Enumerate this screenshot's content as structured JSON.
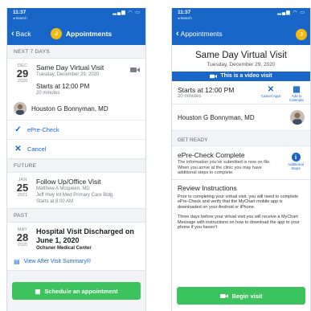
{
  "colors": {
    "brand_blue": "#1866c8",
    "accent_green": "#3cc35e",
    "avatar_yellow": "#f5b90f"
  },
  "status_bar": {
    "time": "11:37",
    "back_app": "◂ Search"
  },
  "left": {
    "nav": {
      "back_label": "Back",
      "avatar_letter": "J",
      "title": "Appointments"
    },
    "sections": {
      "next": "NEXT 7 DAYS",
      "future": "FUTURE",
      "past": "PAST"
    },
    "next_appt": {
      "month": "DEC",
      "day": "29",
      "year": "2020",
      "title": "Same Day Virtual Visit",
      "date": "Tuesday, December 29, 2020",
      "time": "Starts at 12:00 PM",
      "duration": "20 minutes",
      "provider": "Houston G Bonnyman, MD",
      "actions": [
        "ePre-Check",
        "Cancel"
      ]
    },
    "future_appt": {
      "month": "JAN",
      "day": "25",
      "year": "2021",
      "title": "Follow Up/Office Visit",
      "provider": "Matthew A Mcqueen, MD",
      "location": "Jeff Hwy Int Med Primary Care Bldg",
      "time": "Starts at 8:00 AM"
    },
    "past_appt": {
      "month": "MAY",
      "day": "28",
      "year": "2020",
      "title": "Hospital Visit Discharged on June 1, 2020",
      "location": "Ochsner Medical Center",
      "link": "View After Visit Summary®"
    },
    "button": "Schedule an appointment"
  },
  "right": {
    "nav": {
      "back_label": "Appointments",
      "avatar_letter": "J"
    },
    "title": "Same Day Virtual Visit",
    "date": "Tuesday, December 29, 2020",
    "banner": "This is a video visit",
    "time": "Starts at 12:00 PM",
    "duration": "20 minutes",
    "cancel_label": "Cancel Appt",
    "calendar_label": "Add to Calendar",
    "provider": "Houston G Bonnyman, MD",
    "get_ready": "GET READY",
    "epc_title": "ePre-Check Complete",
    "epc_text": "The information you've submitted is now on file. When you arrive at the clinic you may have additional steps to complete.",
    "additional_label": "Additional Steps",
    "review_title": "Review Instructions",
    "review_p1": "Prior to completing your virtual visit, you will need to complete ePre-Check and verify that the MyChart mobile app is downloaded on your Android or iPhone.",
    "review_p2": "Three days before your virtual visit you will receive a MyChart Message with instructions on how to download the app to your phone if you haven't",
    "button": "Begin visit"
  }
}
